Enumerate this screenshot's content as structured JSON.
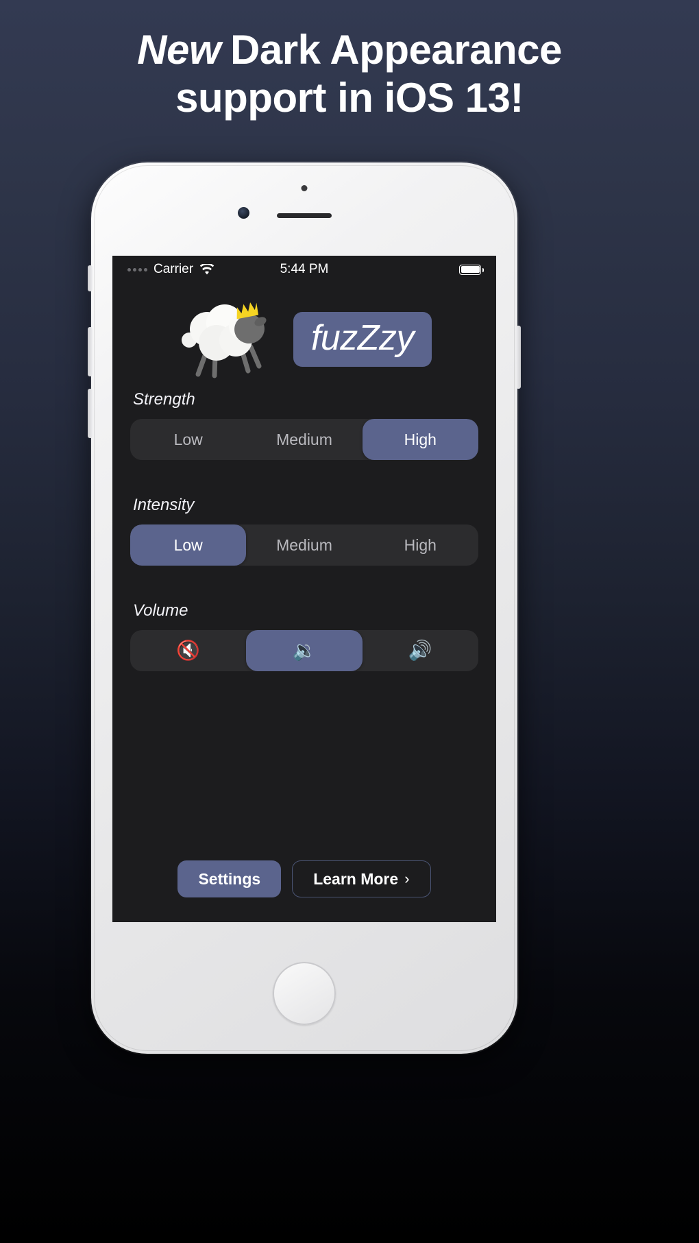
{
  "headline": {
    "emphasis": "New",
    "rest": "Dark Appearance",
    "line2": "support in iOS 13!"
  },
  "colors": {
    "accent": "#5b648d",
    "screen_bg": "#1c1c1e",
    "segment_track": "#2c2c2e",
    "crown": "#f5d423",
    "sheep_body": "#f2f2f0",
    "sheep_head": "#6e6e6e",
    "backdrop_top": "#333a52",
    "backdrop_bottom": "#000000"
  },
  "status_bar": {
    "signal_icon": "signal-dots-icon",
    "carrier": "Carrier",
    "wifi_icon": "wifi-icon",
    "time": "5:44 PM",
    "battery_icon": "battery-full-icon"
  },
  "logo": {
    "sheep_icon": "sheep-with-crown-icon",
    "wordmark": "fuzZzy"
  },
  "sections": [
    {
      "id": "strength",
      "label": "Strength",
      "options": [
        {
          "label": "Low",
          "selected": false
        },
        {
          "label": "Medium",
          "selected": false
        },
        {
          "label": "High",
          "selected": true
        }
      ]
    },
    {
      "id": "intensity",
      "label": "Intensity",
      "options": [
        {
          "label": "Low",
          "selected": true
        },
        {
          "label": "Medium",
          "selected": false
        },
        {
          "label": "High",
          "selected": false
        }
      ]
    },
    {
      "id": "volume",
      "label": "Volume",
      "options": [
        {
          "label": "🔇",
          "icon": "speaker-muted-icon",
          "selected": false
        },
        {
          "label": "🔉",
          "icon": "speaker-low-icon",
          "selected": true
        },
        {
          "label": "🔊",
          "icon": "speaker-high-icon",
          "selected": false
        }
      ]
    }
  ],
  "footer": {
    "settings_label": "Settings",
    "learn_more_label": "Learn More",
    "learn_more_chevron": "›"
  }
}
